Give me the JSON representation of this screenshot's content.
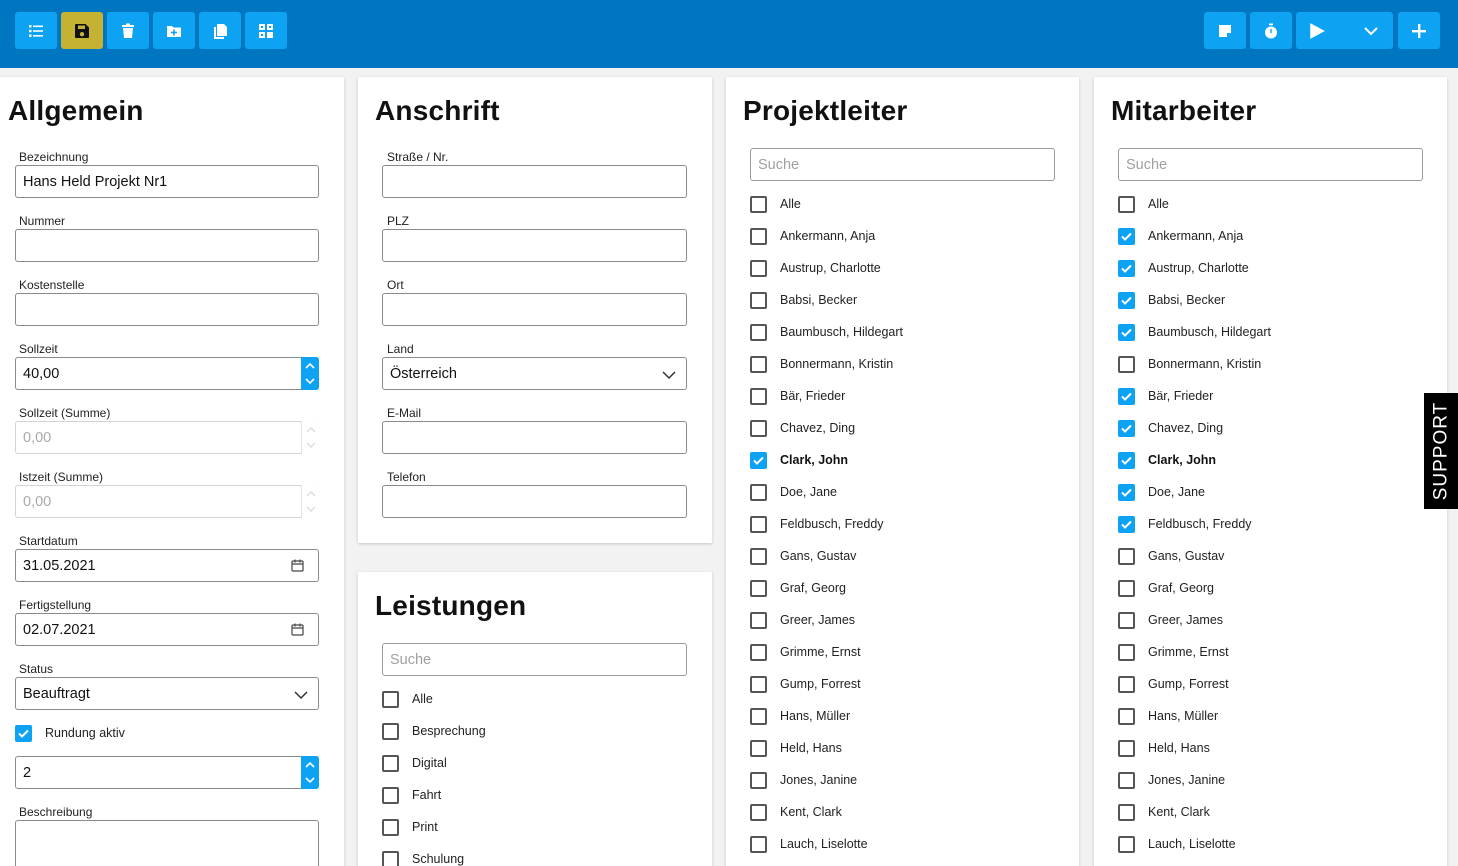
{
  "toolbar": {
    "buttons": [
      {
        "name": "list-icon"
      },
      {
        "name": "save-icon"
      },
      {
        "name": "trash-icon"
      },
      {
        "name": "folder-plus-icon"
      },
      {
        "name": "copy-icon"
      },
      {
        "name": "grid-icon"
      },
      {
        "name": "note-icon"
      },
      {
        "name": "stopwatch-icon"
      },
      {
        "name": "play-icon"
      },
      {
        "name": "chevron-down-icon"
      },
      {
        "name": "plus-icon"
      }
    ],
    "colors": {
      "bar": "#0076c0",
      "button": "#0da3f2",
      "save": "#c5b132"
    }
  },
  "allgemein": {
    "title": "Allgemein",
    "bezeichnung_label": "Bezeichnung",
    "bezeichnung_value": "Hans Held Projekt Nr1",
    "nummer_label": "Nummer",
    "nummer_value": "",
    "kostenstelle_label": "Kostenstelle",
    "kostenstelle_value": "",
    "sollzeit_label": "Sollzeit",
    "sollzeit_value": "40,00",
    "sollzeit_summe_label": "Sollzeit (Summe)",
    "sollzeit_summe_value": "0,00",
    "istzeit_summe_label": "Istzeit (Summe)",
    "istzeit_summe_value": "0,00",
    "startdatum_label": "Startdatum",
    "startdatum_value": "31.05.2021",
    "fertigstellung_label": "Fertigstellung",
    "fertigstellung_value": "02.07.2021",
    "status_label": "Status",
    "status_value": "Beauftragt",
    "rundung_label": "Rundung aktiv",
    "rundung_checked": true,
    "rundung_value": "2",
    "beschreibung_label": "Beschreibung",
    "beschreibung_value": ""
  },
  "anschrift": {
    "title": "Anschrift",
    "strasse_label": "Straße / Nr.",
    "plz_label": "PLZ",
    "ort_label": "Ort",
    "land_label": "Land",
    "land_value": "Österreich",
    "email_label": "E-Mail",
    "telefon_label": "Telefon"
  },
  "leistungen": {
    "title": "Leistungen",
    "search_placeholder": "Suche",
    "items": [
      {
        "label": "Alle",
        "checked": false
      },
      {
        "label": "Besprechung",
        "checked": false
      },
      {
        "label": "Digital",
        "checked": false
      },
      {
        "label": "Fahrt",
        "checked": false
      },
      {
        "label": "Print",
        "checked": false
      },
      {
        "label": "Schulung",
        "checked": false
      }
    ]
  },
  "projektleiter": {
    "title": "Projektleiter",
    "search_placeholder": "Suche",
    "items": [
      {
        "label": "Alle",
        "checked": false,
        "bold": false
      },
      {
        "label": "Ankermann, Anja",
        "checked": false,
        "bold": false
      },
      {
        "label": "Austrup, Charlotte",
        "checked": false,
        "bold": false
      },
      {
        "label": "Babsi, Becker",
        "checked": false,
        "bold": false
      },
      {
        "label": "Baumbusch, Hildegart",
        "checked": false,
        "bold": false
      },
      {
        "label": "Bonnermann, Kristin",
        "checked": false,
        "bold": false
      },
      {
        "label": "Bär, Frieder",
        "checked": false,
        "bold": false
      },
      {
        "label": "Chavez, Ding",
        "checked": false,
        "bold": false
      },
      {
        "label": "Clark, John",
        "checked": true,
        "bold": true
      },
      {
        "label": "Doe, Jane",
        "checked": false,
        "bold": false
      },
      {
        "label": "Feldbusch, Freddy",
        "checked": false,
        "bold": false
      },
      {
        "label": "Gans, Gustav",
        "checked": false,
        "bold": false
      },
      {
        "label": "Graf, Georg",
        "checked": false,
        "bold": false
      },
      {
        "label": "Greer, James",
        "checked": false,
        "bold": false
      },
      {
        "label": "Grimme, Ernst",
        "checked": false,
        "bold": false
      },
      {
        "label": "Gump, Forrest",
        "checked": false,
        "bold": false
      },
      {
        "label": "Hans, Müller",
        "checked": false,
        "bold": false
      },
      {
        "label": "Held, Hans",
        "checked": false,
        "bold": false
      },
      {
        "label": "Jones, Janine",
        "checked": false,
        "bold": false
      },
      {
        "label": "Kent, Clark",
        "checked": false,
        "bold": false
      },
      {
        "label": "Lauch, Liselotte",
        "checked": false,
        "bold": false
      }
    ]
  },
  "mitarbeiter": {
    "title": "Mitarbeiter",
    "search_placeholder": "Suche",
    "items": [
      {
        "label": "Alle",
        "checked": false,
        "bold": false
      },
      {
        "label": "Ankermann, Anja",
        "checked": true,
        "bold": false
      },
      {
        "label": "Austrup, Charlotte",
        "checked": true,
        "bold": false
      },
      {
        "label": "Babsi, Becker",
        "checked": true,
        "bold": false
      },
      {
        "label": "Baumbusch, Hildegart",
        "checked": true,
        "bold": false
      },
      {
        "label": "Bonnermann, Kristin",
        "checked": false,
        "bold": false
      },
      {
        "label": "Bär, Frieder",
        "checked": true,
        "bold": false
      },
      {
        "label": "Chavez, Ding",
        "checked": true,
        "bold": false
      },
      {
        "label": "Clark, John",
        "checked": true,
        "bold": true
      },
      {
        "label": "Doe, Jane",
        "checked": true,
        "bold": false
      },
      {
        "label": "Feldbusch, Freddy",
        "checked": true,
        "bold": false
      },
      {
        "label": "Gans, Gustav",
        "checked": false,
        "bold": false
      },
      {
        "label": "Graf, Georg",
        "checked": false,
        "bold": false
      },
      {
        "label": "Greer, James",
        "checked": false,
        "bold": false
      },
      {
        "label": "Grimme, Ernst",
        "checked": false,
        "bold": false
      },
      {
        "label": "Gump, Forrest",
        "checked": false,
        "bold": false
      },
      {
        "label": "Hans, Müller",
        "checked": false,
        "bold": false
      },
      {
        "label": "Held, Hans",
        "checked": false,
        "bold": false
      },
      {
        "label": "Jones, Janine",
        "checked": false,
        "bold": false
      },
      {
        "label": "Kent, Clark",
        "checked": false,
        "bold": false
      },
      {
        "label": "Lauch, Liselotte",
        "checked": false,
        "bold": false
      }
    ]
  },
  "support": {
    "label": "SUPPORT"
  }
}
